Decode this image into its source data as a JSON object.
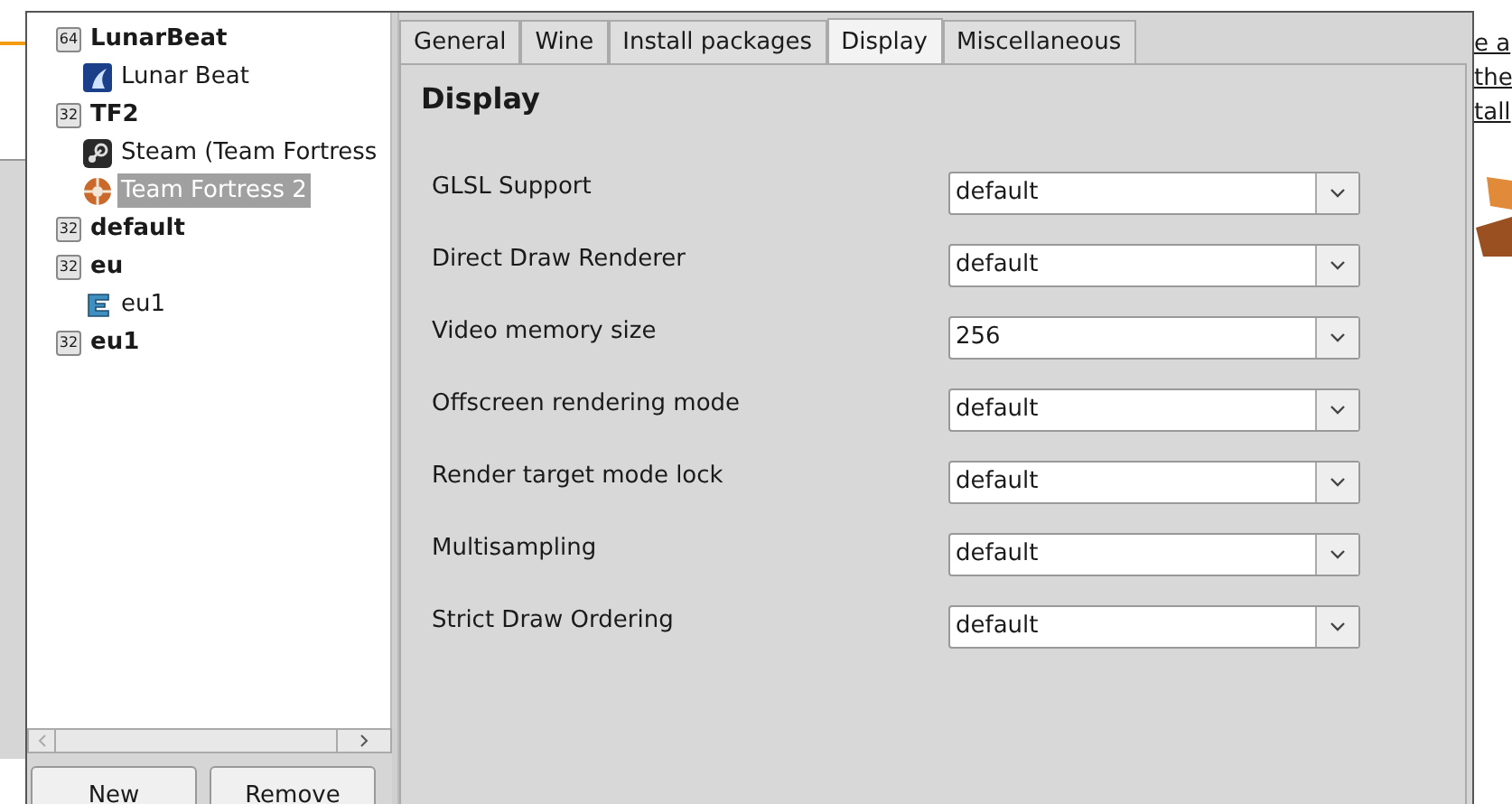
{
  "background_window": {
    "links": [
      "e a",
      "the",
      "tall"
    ]
  },
  "prefix_tree": [
    {
      "label": "LunarBeat",
      "badge": "64",
      "children": [
        {
          "label": "Lunar Beat",
          "kind": "moon",
          "selected": false
        }
      ]
    },
    {
      "label": "TF2",
      "badge": "32",
      "children": [
        {
          "label": "Steam (Team Fortress",
          "kind": "steam",
          "selected": false
        },
        {
          "label": "Team Fortress 2",
          "kind": "tf2",
          "selected": true
        }
      ]
    },
    {
      "label": "default",
      "badge": "32"
    },
    {
      "label": "eu",
      "badge": "32",
      "children": [
        {
          "label": "eu1",
          "kind": "letter-e",
          "selected": false
        }
      ]
    },
    {
      "label": "eu1",
      "badge": "32"
    }
  ],
  "buttons": [
    "New",
    "Remove"
  ],
  "tabs": [
    {
      "label": "General",
      "selected": false
    },
    {
      "label": "Wine",
      "selected": false
    },
    {
      "label": "Install packages",
      "selected": false
    },
    {
      "label": "Display",
      "selected": true
    },
    {
      "label": "Miscellaneous",
      "selected": false
    }
  ],
  "section_title": "Display",
  "settings": [
    {
      "label": "GLSL Support",
      "value": "default"
    },
    {
      "label": "Direct Draw Renderer",
      "value": "default"
    },
    {
      "label": "Video memory size",
      "value": "256"
    },
    {
      "label": "Offscreen rendering mode",
      "value": "default"
    },
    {
      "label": "Render target mode lock",
      "value": "default"
    },
    {
      "label": "Multisampling",
      "value": "default"
    },
    {
      "label": "Strict Draw Ordering",
      "value": "default"
    }
  ]
}
